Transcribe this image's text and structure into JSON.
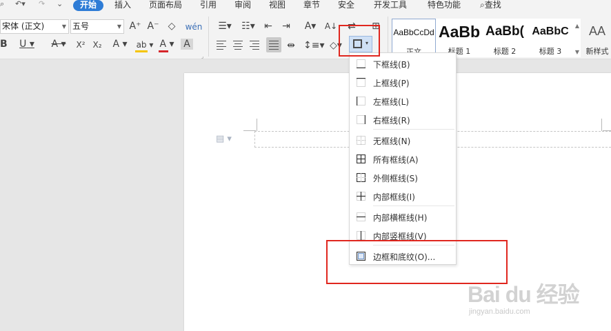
{
  "menubar": {
    "tabs": [
      "开始",
      "插入",
      "页面布局",
      "引用",
      "审阅",
      "视图",
      "章节",
      "安全",
      "开发工具",
      "特色功能"
    ],
    "search_label": "查找"
  },
  "ribbon": {
    "font_name": "宋体 (正文)",
    "font_size": "五号",
    "styles": [
      {
        "preview": "AaBbCcDd",
        "name": "正文"
      },
      {
        "preview": "AaBb",
        "name": "标题 1"
      },
      {
        "preview": "AaBb(",
        "name": "标题 2"
      },
      {
        "preview": "AaBbC",
        "name": "标题 3"
      },
      {
        "preview": "AA",
        "name": "新样式"
      }
    ],
    "icons": {
      "grow_font": "A⁺",
      "shrink_font": "A⁻",
      "clear_format": "◇",
      "phonetic": "wén",
      "bold": "B",
      "underline": "U",
      "strikethrough": "A",
      "superscript": "X²",
      "subscript": "X₂",
      "text_effect": "A",
      "highlight": "ab",
      "font_color": "A",
      "char_shading": "A",
      "case": "A",
      "sort": "A↓",
      "line_spacing": "↕",
      "shading": "◇"
    }
  },
  "border_menu": {
    "items": [
      {
        "label": "下框线(B)",
        "icon": "border-bottom-icon"
      },
      {
        "label": "上框线(P)",
        "icon": "border-top-icon"
      },
      {
        "label": "左框线(L)",
        "icon": "border-left-icon"
      },
      {
        "label": "右框线(R)",
        "icon": "border-right-icon"
      },
      {
        "label": "无框线(N)",
        "icon": "border-none-icon"
      },
      {
        "label": "所有框线(A)",
        "icon": "border-all-icon"
      },
      {
        "label": "外侧框线(S)",
        "icon": "border-outside-icon"
      },
      {
        "label": "内部框线(I)",
        "icon": "border-inside-icon"
      },
      {
        "label": "内部横框线(H)",
        "icon": "border-inside-horizontal-icon"
      },
      {
        "label": "内部竖框线(V)",
        "icon": "border-inside-vertical-icon"
      },
      {
        "label": "边框和底纹(O)...",
        "icon": "borders-and-shading-icon"
      }
    ]
  },
  "watermark": {
    "brand": "Bai du 经验",
    "site": "jingyan.baidu.com"
  },
  "colors": {
    "accent": "#2e7cd6",
    "highlight_red": "#e0261e",
    "font_color_bar": "#d6262b",
    "highlight_bar": "#f5c400"
  }
}
